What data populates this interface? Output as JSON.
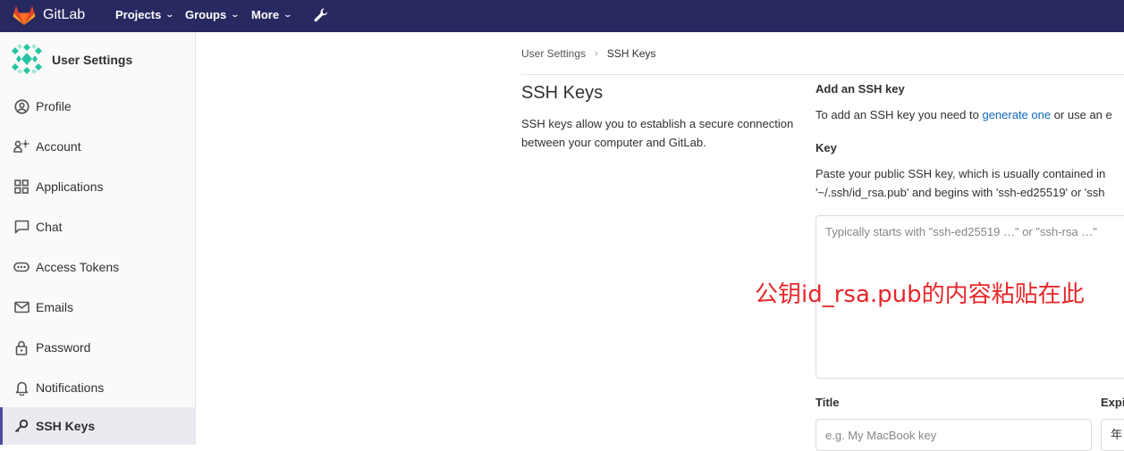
{
  "navbar": {
    "brand": "GitLab",
    "items": [
      {
        "label": "Projects"
      },
      {
        "label": "Groups"
      },
      {
        "label": "More"
      }
    ],
    "bg_color": "#292961"
  },
  "sidebar": {
    "title": "User Settings",
    "items": [
      {
        "label": "Profile",
        "icon": "profile-icon"
      },
      {
        "label": "Account",
        "icon": "account-icon"
      },
      {
        "label": "Applications",
        "icon": "applications-icon"
      },
      {
        "label": "Chat",
        "icon": "chat-icon"
      },
      {
        "label": "Access Tokens",
        "icon": "token-icon"
      },
      {
        "label": "Emails",
        "icon": "mail-icon"
      },
      {
        "label": "Password",
        "icon": "lock-icon"
      },
      {
        "label": "Notifications",
        "icon": "bell-icon"
      },
      {
        "label": "SSH Keys",
        "icon": "key-icon",
        "active": true
      }
    ]
  },
  "breadcrumb": {
    "parent": "User Settings",
    "current": "SSH Keys"
  },
  "page": {
    "title": "SSH Keys",
    "description": "SSH keys allow you to establish a secure connection between your computer and GitLab."
  },
  "add_key": {
    "heading": "Add an SSH key",
    "intro_before": "To add an SSH key you need to ",
    "intro_link": "generate one",
    "intro_after": " or use an e",
    "key_label": "Key",
    "key_help_line1": "Paste your public SSH key, which is usually contained in",
    "key_help_line2": "'~/.ssh/id_rsa.pub' and begins with 'ssh-ed25519' or 'ssh",
    "key_placeholder": "Typically starts with \"ssh-ed25519 …\" or \"ssh-rsa …\"",
    "annotation": "公钥id_rsa.pub的内容粘贴在此",
    "title_label": "Title",
    "title_placeholder": "e.g. My MacBook key",
    "expires_label": "Expi",
    "expires_value": "年"
  },
  "colors": {
    "link": "#1068bf",
    "annotation": "#e8262a",
    "sidebar_active": "#4b4ba3"
  }
}
